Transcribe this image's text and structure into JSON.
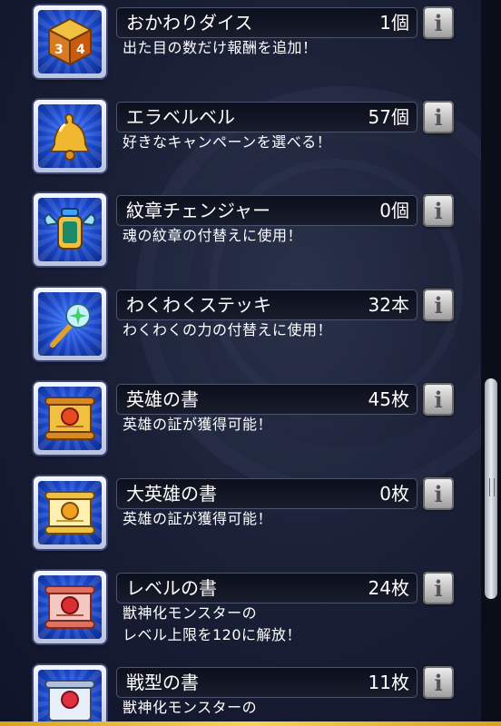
{
  "items": [
    {
      "name": "おかわりダイス",
      "count": "1個",
      "desc": "出た目の数だけ報酬を追加！",
      "icon": "dice-icon"
    },
    {
      "name": "エラベルベル",
      "count": "57個",
      "desc": "好きなキャンペーンを選べる！",
      "icon": "bell-icon"
    },
    {
      "name": "紋章チェンジャー",
      "count": "0個",
      "desc": "魂の紋章の付替えに使用！",
      "icon": "crest-changer-icon"
    },
    {
      "name": "わくわくステッキ",
      "count": "32本",
      "desc": "わくわくの力の付替えに使用！",
      "icon": "wand-icon"
    },
    {
      "name": "英雄の書",
      "count": "45枚",
      "desc": "英雄の証が獲得可能！",
      "icon": "hero-book-icon"
    },
    {
      "name": "大英雄の書",
      "count": "0枚",
      "desc": "英雄の証が獲得可能！",
      "icon": "great-hero-book-icon"
    },
    {
      "name": "レベルの書",
      "count": "24枚",
      "desc": "獣神化モンスターの\nレベル上限を120に解放！",
      "icon": "level-book-icon"
    },
    {
      "name": "戦型の書",
      "count": "11枚",
      "desc": "獣神化モンスターの",
      "icon": "battle-type-book-icon"
    }
  ],
  "info_label": "i",
  "colors": {
    "icon_bg": "#1a46c8",
    "accent_gold": "#f6d35a"
  }
}
